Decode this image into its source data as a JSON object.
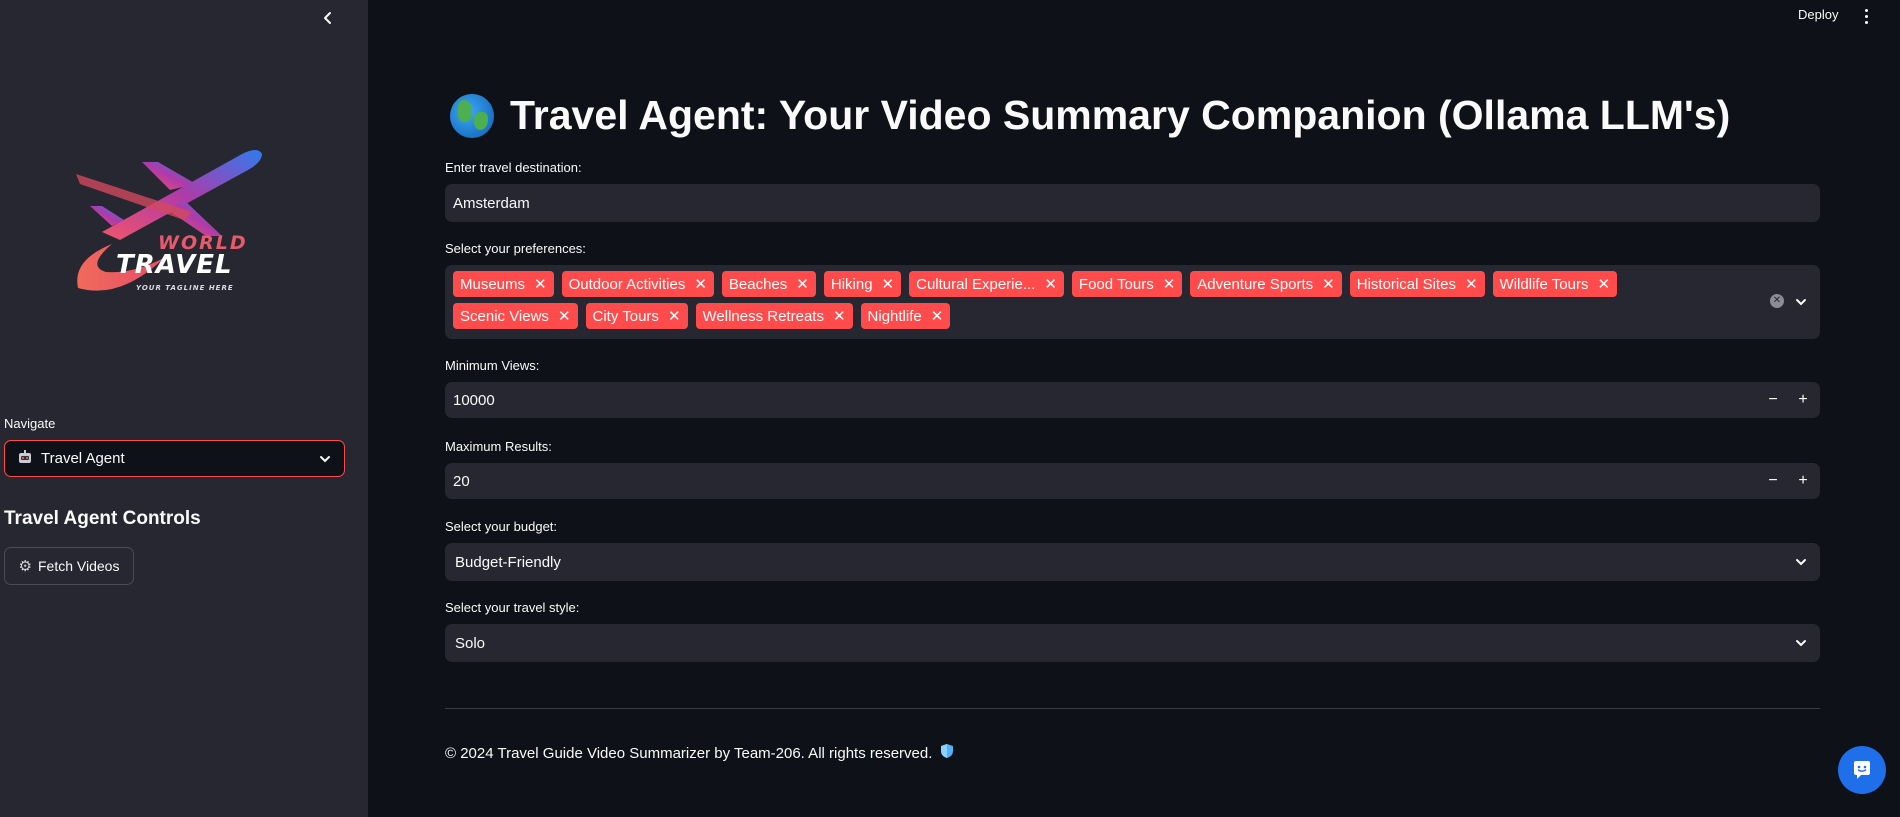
{
  "sidebar": {
    "logo": {
      "line1": "WORLD",
      "line2": "TRAVEL",
      "tagline": "YOUR TAGLINE HERE"
    },
    "nav_label": "Navigate",
    "nav_selected": "Travel Agent",
    "controls_title": "Travel Agent Controls",
    "fetch_button": "Fetch Videos"
  },
  "header": {
    "deploy": "Deploy"
  },
  "main": {
    "title": "Travel Agent: Your Video Summary Companion (Ollama LLM's)",
    "destination": {
      "label": "Enter travel destination:",
      "value": "Amsterdam"
    },
    "preferences": {
      "label": "Select your preferences:",
      "tags": [
        "Museums",
        "Outdoor Activities",
        "Beaches",
        "Hiking",
        "Cultural Experie...",
        "Food Tours",
        "Adventure Sports",
        "Historical Sites",
        "Wildlife Tours",
        "Scenic Views",
        "City Tours",
        "Wellness Retreats",
        "Nightlife"
      ]
    },
    "min_views": {
      "label": "Minimum Views:",
      "value": "10000"
    },
    "max_results": {
      "label": "Maximum Results:",
      "value": "20"
    },
    "budget": {
      "label": "Select your budget:",
      "value": "Budget-Friendly"
    },
    "travel_style": {
      "label": "Select your travel style:",
      "value": "Solo"
    },
    "footer": "© 2024 Travel Guide Video Summarizer by Team-206. All rights reserved."
  },
  "colors": {
    "accent": "#ff4b4b",
    "background": "#0e1117",
    "sidebar": "#262730",
    "fab": "#1f6feb"
  },
  "icons": [
    "chevron-left-icon",
    "robot-icon",
    "chevron-down-icon",
    "gear-icon",
    "kebab-menu-icon",
    "globe-icon",
    "close-icon",
    "clear-icon",
    "minus-icon",
    "plus-icon",
    "shield-icon",
    "chat-icon"
  ]
}
